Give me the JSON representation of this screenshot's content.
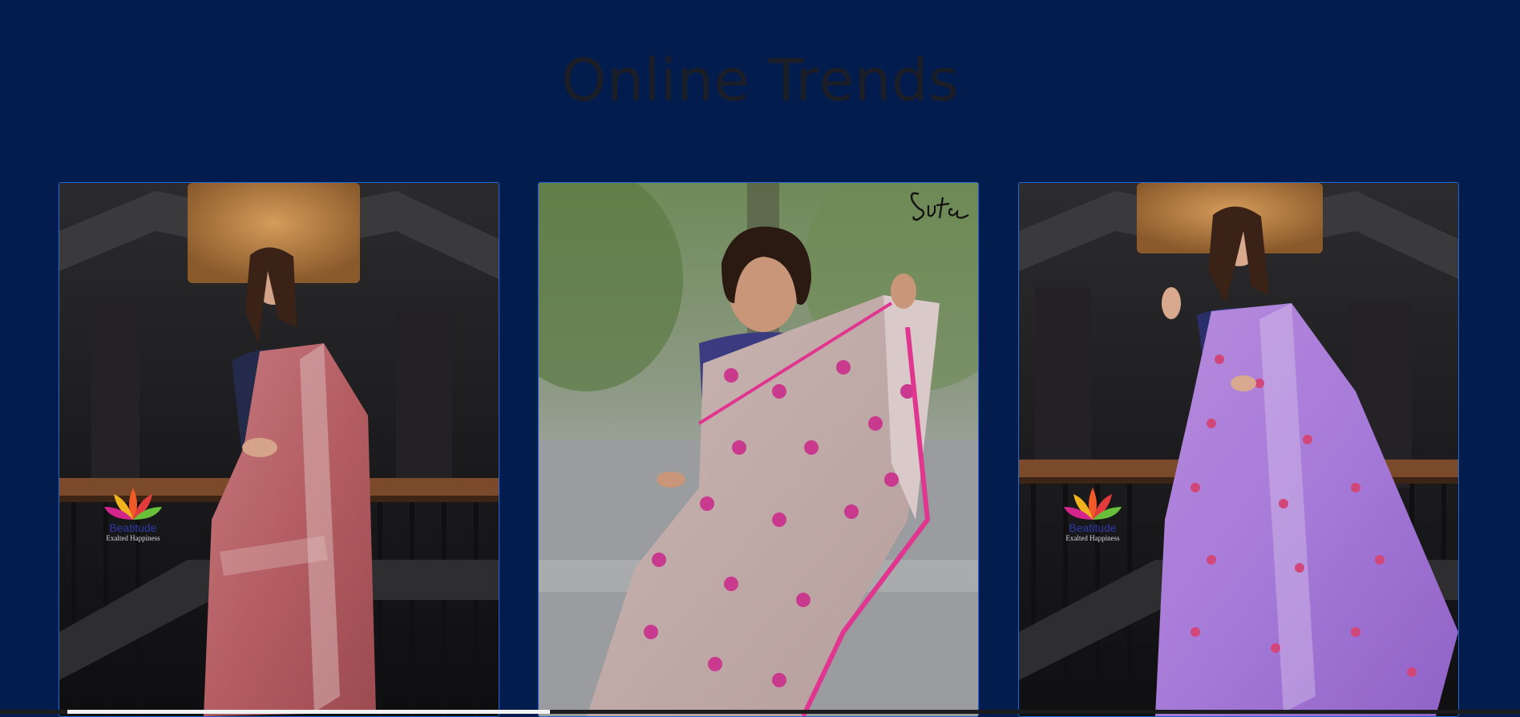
{
  "section": {
    "title": "Online Trends"
  },
  "products": [
    {
      "brand": "Beatitude",
      "tagline": "Exalted Happiness",
      "accent": "#b8585e"
    },
    {
      "signature": "Suta",
      "accent": "#d6348c"
    },
    {
      "brand": "Beatitude",
      "tagline": "Exalted Happiness",
      "accent": "#a67ad8"
    }
  ],
  "colors": {
    "background": "#021c4e",
    "card_border": "#1f68d6",
    "title": "#1b1d27"
  },
  "icons": [
    "beatitude-lotus-logo",
    "suta-signature-logo"
  ],
  "scroll": {
    "horizontal_position": 0.04
  }
}
